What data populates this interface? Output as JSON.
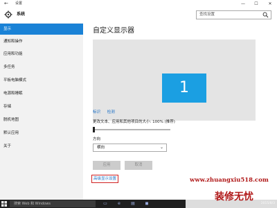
{
  "window": {
    "title": "设置",
    "back_glyph": "←",
    "minimize": "—",
    "maximize": "☐",
    "close": "✕"
  },
  "header": {
    "title": "系统",
    "search_placeholder": "查找设置"
  },
  "sidebar": {
    "items": [
      {
        "label": "显示",
        "active": true
      },
      {
        "label": "通知和操作"
      },
      {
        "label": "应用和功能"
      },
      {
        "label": "多任务"
      },
      {
        "label": "平板电脑模式"
      },
      {
        "label": "电源和睡眠"
      },
      {
        "label": "存储"
      },
      {
        "label": "脱机地图"
      },
      {
        "label": "默认应用"
      },
      {
        "label": "关于"
      }
    ]
  },
  "main": {
    "heading": "自定义显示器",
    "monitor_number": "1",
    "identify_link": "标识",
    "detect_link": "检测",
    "scale_label": "更改文本、应用和其他项目的大小: 100% (推荐)",
    "scale_value_fraction": 0,
    "orientation_label": "方向",
    "orientation_value": "横向",
    "apply_button": "应用",
    "cancel_button": "取消",
    "advanced_link": "高级显示设置"
  },
  "taskbar": {
    "search_placeholder": "搜索 Web 和 Windows",
    "tray_text": "2015/8/3"
  },
  "watermark": {
    "url": "www.zhuangxiu518.com",
    "name": "装修无忧"
  },
  "colors": {
    "accent": "#1a82d6",
    "monitor": "#1b9fe2",
    "watermark": "#b01818"
  }
}
